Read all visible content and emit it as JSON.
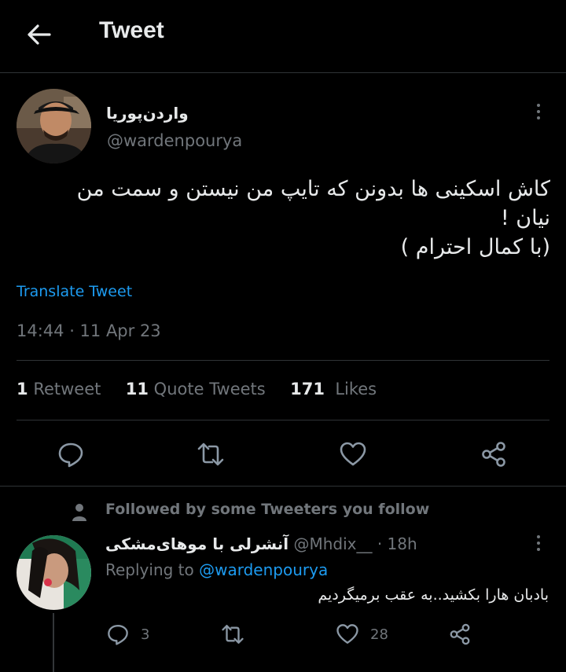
{
  "header": {
    "title": "Tweet",
    "back_icon": "arrow-left-icon"
  },
  "tweet": {
    "author_name": "واردن‌پوریا",
    "author_handle": "@wardenpourya",
    "text_line1": "کاش اسکینی ها بدونن که تایپ من نیستن و سمت من",
    "text_line2": "نیان !",
    "text_line3": "(با کمال احترام )",
    "translate_label": "Translate Tweet",
    "timestamp": "14:44 · 11 Apr 23",
    "retweet_count": "1",
    "retweet_label": "Retweet",
    "quote_count": "11",
    "quote_label": "Quote Tweets",
    "like_count": "171",
    "like_label": "Likes"
  },
  "actions": {
    "reply_icon": "reply-icon",
    "retweet_icon": "retweet-icon",
    "like_icon": "heart-icon",
    "share_icon": "share-icon"
  },
  "reply": {
    "context": "Followed by some Tweeters you follow",
    "author_name": "آنشرلی با موهای‌مشکی",
    "author_handle": "@Mhdix__",
    "time": "· 18h",
    "replying_prefix": "Replying to",
    "replying_to": "@wardenpourya",
    "text": "بادبان هارا بکشید..به عقب برمیگردیم",
    "reply_count": "3",
    "like_count": "28"
  },
  "colors": {
    "background": "#000000",
    "text": "#e7e9ea",
    "muted": "#71767b",
    "link": "#1d9bf0",
    "divider": "#2f3336"
  }
}
